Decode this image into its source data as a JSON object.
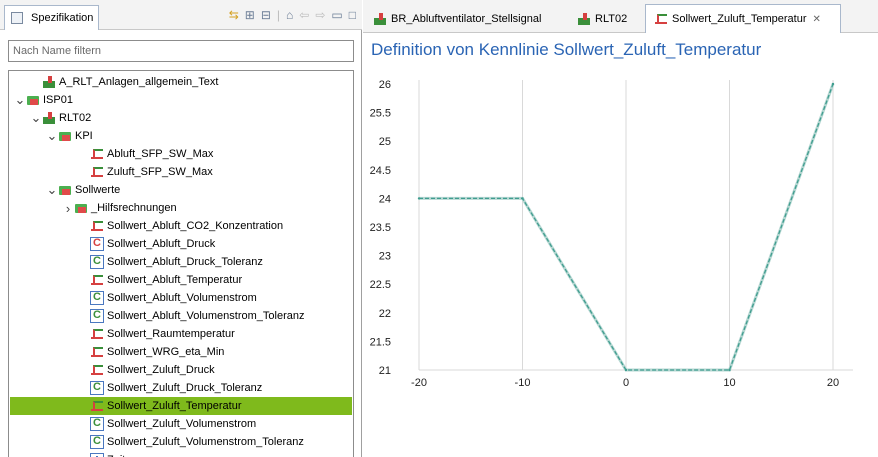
{
  "left_panel": {
    "view_tab_label": "Spezifikation",
    "filter_placeholder": "Nach Name filtern",
    "tree": [
      {
        "label": "A_RLT_Anlagen_allgemein_Text",
        "depth": 1,
        "icon": "plant-icon",
        "chevron": ""
      },
      {
        "label": "ISP01",
        "depth": 0,
        "icon": "folder-icon",
        "chevron": "v"
      },
      {
        "label": "RLT02",
        "depth": 1,
        "icon": "plant-icon",
        "chevron": "v"
      },
      {
        "label": "KPI",
        "depth": 2,
        "icon": "folder-icon",
        "chevron": "v"
      },
      {
        "label": "Abluft_SFP_SW_Max",
        "depth": 4,
        "icon": "curve-icon",
        "chevron": ""
      },
      {
        "label": "Zuluft_SFP_SW_Max",
        "depth": 4,
        "icon": "curve-icon",
        "chevron": ""
      },
      {
        "label": "Sollwerte",
        "depth": 2,
        "icon": "folder-icon",
        "chevron": "v"
      },
      {
        "label": "_Hilfsrechnungen",
        "depth": 3,
        "icon": "folder-icon",
        "chevron": ">"
      },
      {
        "label": "Sollwert_Abluft_CO2_Konzentration",
        "depth": 4,
        "icon": "curve-icon",
        "chevron": ""
      },
      {
        "label": "Sollwert_Abluft_Druck",
        "depth": 4,
        "icon": "param-red-icon",
        "chevron": ""
      },
      {
        "label": "Sollwert_Abluft_Druck_Toleranz",
        "depth": 4,
        "icon": "param-icon",
        "chevron": ""
      },
      {
        "label": "Sollwert_Abluft_Temperatur",
        "depth": 4,
        "icon": "curve-icon",
        "chevron": ""
      },
      {
        "label": "Sollwert_Abluft_Volumenstrom",
        "depth": 4,
        "icon": "param-icon",
        "chevron": ""
      },
      {
        "label": "Sollwert_Abluft_Volumenstrom_Toleranz",
        "depth": 4,
        "icon": "param-icon",
        "chevron": ""
      },
      {
        "label": "Sollwert_Raumtemperatur",
        "depth": 4,
        "icon": "curve-icon",
        "chevron": ""
      },
      {
        "label": "Sollwert_WRG_eta_Min",
        "depth": 4,
        "icon": "curve-icon",
        "chevron": ""
      },
      {
        "label": "Sollwert_Zuluft_Druck",
        "depth": 4,
        "icon": "curve-icon",
        "chevron": ""
      },
      {
        "label": "Sollwert_Zuluft_Druck_Toleranz",
        "depth": 4,
        "icon": "param-icon",
        "chevron": ""
      },
      {
        "label": "Sollwert_Zuluft_Temperatur",
        "depth": 4,
        "icon": "curve-icon",
        "chevron": "",
        "selected": true
      },
      {
        "label": "Sollwert_Zuluft_Volumenstrom",
        "depth": 4,
        "icon": "param-icon",
        "chevron": ""
      },
      {
        "label": "Sollwert_Zuluft_Volumenstrom_Toleranz",
        "depth": 4,
        "icon": "param-icon",
        "chevron": ""
      },
      {
        "label": "Zeitprogramm",
        "depth": 4,
        "icon": "clock-icon",
        "chevron": ""
      }
    ]
  },
  "editor_tabs": [
    {
      "label": "BR_Abluftventilator_Stellsignal",
      "icon": "plant-icon",
      "active": false
    },
    {
      "label": "RLT02",
      "icon": "plant-icon",
      "active": false
    },
    {
      "label": "Sollwert_Zuluft_Temperatur",
      "icon": "curve-icon",
      "active": true,
      "close": "✕"
    }
  ],
  "editor_title": "Definition von Kennlinie Sollwert_Zuluft_Temperatur",
  "colors": {
    "selection": "#7fba1c",
    "line": "#3f9d8f",
    "title": "#2a64b4"
  },
  "chart_data": {
    "type": "line",
    "x": [
      -20,
      -10,
      0,
      10,
      20
    ],
    "values": [
      24,
      24,
      21,
      21,
      26
    ],
    "xlim": [
      -20,
      20
    ],
    "ylim": [
      21,
      26
    ],
    "xticks": [
      -20,
      -10,
      0,
      10,
      20
    ],
    "yticks": [
      21,
      21.5,
      22,
      22.5,
      23,
      23.5,
      24,
      24.5,
      25,
      25.5,
      26
    ],
    "grid": "x-only"
  }
}
